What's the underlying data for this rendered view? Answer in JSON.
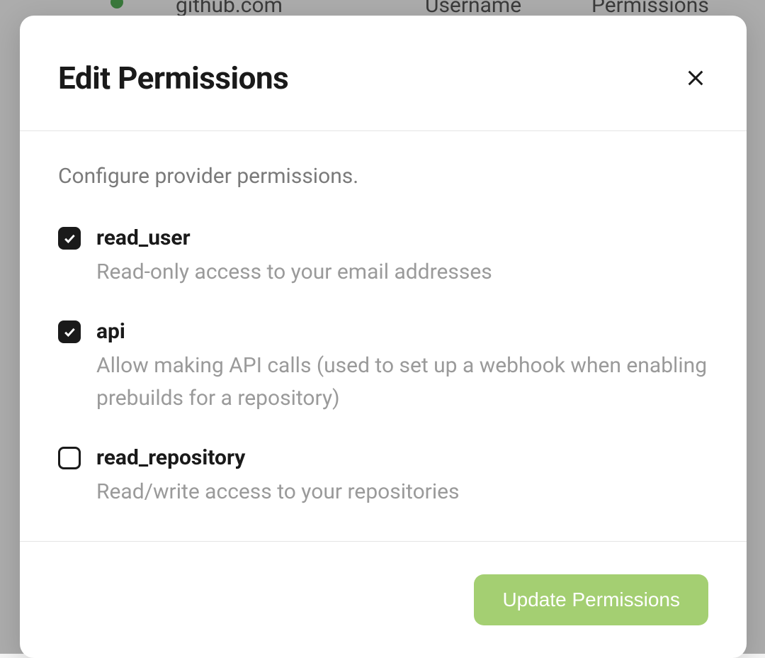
{
  "background": {
    "provider": "github.com",
    "col_username": "Username",
    "col_permissions": "Permissions"
  },
  "modal": {
    "title": "Edit Permissions",
    "description": "Configure provider permissions.",
    "permissions": [
      {
        "name": "read_user",
        "description": "Read-only access to your email addresses",
        "checked": true
      },
      {
        "name": "api",
        "description": "Allow making API calls (used to set up a webhook when enabling prebuilds for a repository)",
        "checked": true
      },
      {
        "name": "read_repository",
        "description": "Read/write access to your repositories",
        "checked": false
      }
    ],
    "update_button": "Update Permissions"
  }
}
